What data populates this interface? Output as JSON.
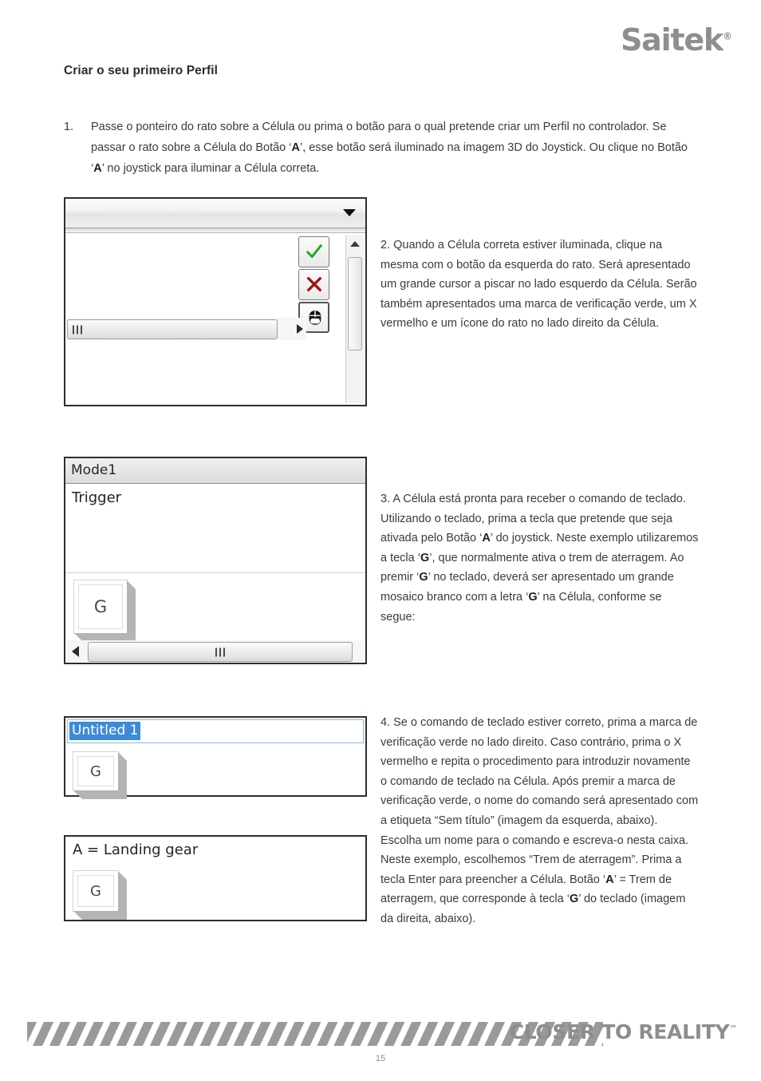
{
  "brand": {
    "name": "Saitek",
    "registered_mark": "®"
  },
  "page": {
    "title": "Criar o seu primeiro Perfil",
    "number": "15"
  },
  "steps": {
    "step1": {
      "number": "1.",
      "text_before_a1": "Passe o ponteiro do rato sobre a Célula ou prima o botão para o qual pretende criar um Perfil no controlador. Se passar o rato sobre a Célula do Botão ‘",
      "key_a1": "A",
      "text_mid": "’, esse botão será iluminado na imagem 3D do Joystick. Ou clique no Botão ‘",
      "key_a2": "A",
      "text_after": "’ no joystick para iluminar a Célula correta."
    },
    "step2": {
      "text": "2.   Quando a Célula correta estiver iluminada, clique na mesma com o botão da esquerda do rato. Será apresentado um grande cursor a piscar no lado esquerdo da Célula. Serão também apresentados uma marca de verificação verde, um X vermelho e um ícone do rato no lado direito da Célula."
    },
    "step3": {
      "seg1": "3.   A Célula está pronta para receber o comando de teclado. Utilizando o teclado, prima a tecla que pretende que seja ativada pelo Botão ‘",
      "key_a": "A",
      "seg2": "’ do joystick. Neste exemplo utilizaremos a tecla ‘",
      "key_g1": "G",
      "seg3": "’, que normalmente ativa o trem de aterragem. Ao premir ‘",
      "key_g2": "G",
      "seg4": "’ no teclado, deverá ser apresentado um grande mosaico branco com a letra ‘",
      "key_g3": "G",
      "seg5": "’ na Célula, conforme se segue:"
    },
    "step4": {
      "seg1": "4.   Se o comando de teclado estiver correto, prima a marca de verificação verde no lado direito. Caso contrário, prima o X vermelho e repita o procedimento para introduzir novamente o comando de teclado na Célula. Após premir a marca de verificação verde, o nome do comando será apresentado com a etiqueta “Sem título” (imagem da esquerda, abaixo).  Escolha um nome para o comando e escreva-o nesta caixa. Neste exemplo, escolhemos “Trem de aterragem”. Prima a tecla Enter para preencher a Célula. Botão ‘",
      "key_a": "A",
      "seg2": "’ = Trem de aterragem, que corresponde à tecla ‘",
      "key_g": "G",
      "seg3": "’ do teclado (imagem da direita, abaixo)."
    }
  },
  "screenshots": {
    "panel1": {
      "combo_value": "",
      "buttons": [
        {
          "name": "accept",
          "icon": "check-icon",
          "color": "#2aa82a"
        },
        {
          "name": "cancel",
          "icon": "x-icon",
          "color": "#9e1414"
        },
        {
          "name": "mouse",
          "icon": "mouse-icon",
          "color": "#111111"
        }
      ]
    },
    "panel2": {
      "header": "Mode1",
      "field_label": "Trigger",
      "key_tile": "G"
    },
    "panel3": {
      "edit_value": "Untitled 1",
      "key_tile": "G",
      "selection_color": "#3e8ad8"
    },
    "panel4": {
      "label": "A = Landing gear",
      "key_tile": "G"
    }
  },
  "footer": {
    "tagline": "CLOSER TO REALITY",
    "tm": "™"
  }
}
